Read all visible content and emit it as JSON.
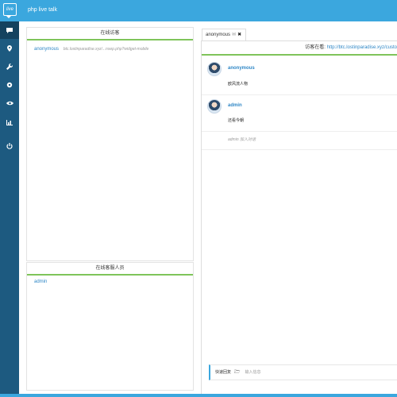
{
  "app": {
    "logo_text": "live",
    "title": "php live talk"
  },
  "sidebar": {
    "items": [
      {
        "icon": "chat-icon",
        "active": true
      },
      {
        "icon": "map-marker-icon"
      },
      {
        "icon": "wrench-icon"
      },
      {
        "icon": "gear-icon"
      },
      {
        "icon": "eye-icon"
      },
      {
        "icon": "bar-chart-icon"
      },
      {
        "icon": "power-icon"
      }
    ]
  },
  "online_visitors": {
    "title": "在线访客",
    "rows": [
      {
        "name": "anonymous",
        "url": "btc.lostinparadise.xyz/...nsep.php?widget-mobile"
      }
    ]
  },
  "online_staff": {
    "title": "在线客服人员",
    "rows": [
      {
        "name": "admin"
      }
    ]
  },
  "chat": {
    "tab_label": "anonymous",
    "visiting_label": "访客在看:",
    "visiting_url": "http://btc.lostinparadise.xyz/custo",
    "messages": [
      {
        "name": "anonymous",
        "text": "欧风流人物"
      },
      {
        "name": "admin",
        "text": "还看今朝"
      }
    ],
    "system_note": "admin 加入对话",
    "quick_reply_label": "快速回复",
    "input_placeholder": "输入信息"
  }
}
